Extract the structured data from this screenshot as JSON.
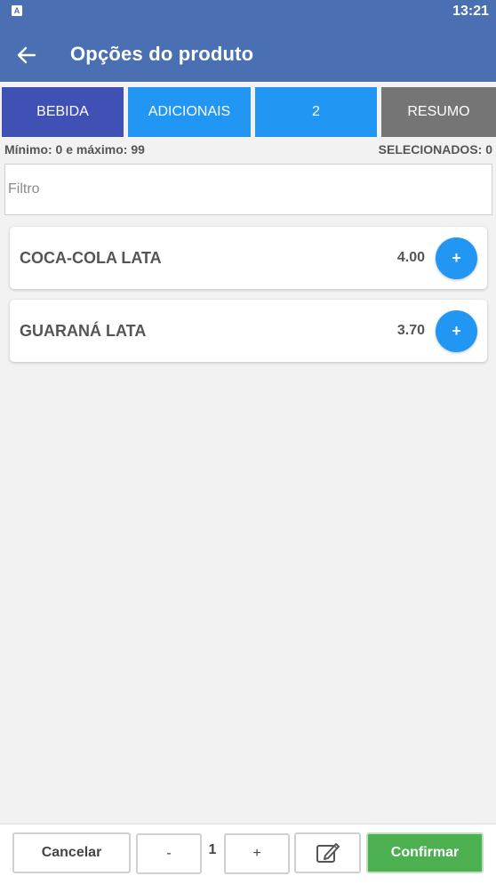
{
  "status_bar": {
    "app_badge": "A",
    "time": "13:21"
  },
  "app_bar": {
    "back_icon": "arrow-left-icon",
    "title": "Opções do produto"
  },
  "tabs": [
    {
      "label": "BEBIDA"
    },
    {
      "label": "ADICIONAIS"
    },
    {
      "label": "2"
    },
    {
      "label": "RESUMO"
    }
  ],
  "info": {
    "limits": "Mínimo: 0 e máximo: 99",
    "selected": "SELECIONADOS: 0"
  },
  "filter": {
    "placeholder": "Filtro",
    "value": ""
  },
  "products": [
    {
      "name": "COCA-COLA LATA",
      "price": "4.00",
      "add_label": "+"
    },
    {
      "name": "GUARANÁ LATA",
      "price": "3.70",
      "add_label": "+"
    }
  ],
  "footer": {
    "cancel_label": "Cancelar",
    "minus_label": "-",
    "quantity": "1",
    "plus_label": "+",
    "edit_icon": "edit-note-icon",
    "confirm_label": "Confirmar"
  },
  "colors": {
    "app_bar": "#4a6fb3",
    "tab_active": "#3f51b5",
    "tab_default": "#2196f3",
    "tab_summary": "#757575",
    "add_button": "#2196f3",
    "confirm": "#4caf50"
  }
}
